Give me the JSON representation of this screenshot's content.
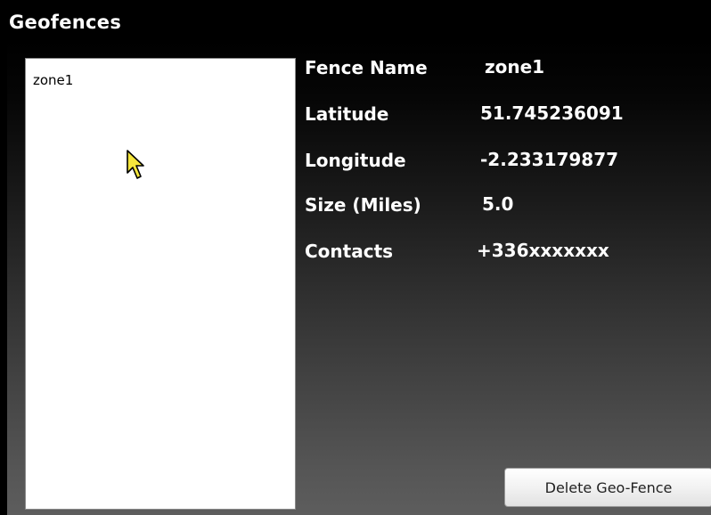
{
  "window": {
    "title": "Geofences"
  },
  "fence_list": {
    "items": [
      {
        "label": "zone1"
      }
    ]
  },
  "details": {
    "fence_name": {
      "label": "Fence Name",
      "value": "zone1"
    },
    "latitude": {
      "label": "Latitude",
      "value": "51.745236091"
    },
    "longitude": {
      "label": "Longitude",
      "value": "-2.233179877"
    },
    "size": {
      "label": "Size (Miles)",
      "value": "5.0"
    },
    "contacts": {
      "label": "Contacts",
      "value": "+336xxxxxxx"
    }
  },
  "actions": {
    "delete_label": "Delete Geo-Fence"
  },
  "icons": {
    "cursor": "mouse-pointer-icon"
  },
  "colors": {
    "title_bar": "#000000",
    "panel_top": "#000000",
    "panel_bottom": "#5d5d5d",
    "text": "#ffffff",
    "cursor_fill": "#f5e63c"
  }
}
